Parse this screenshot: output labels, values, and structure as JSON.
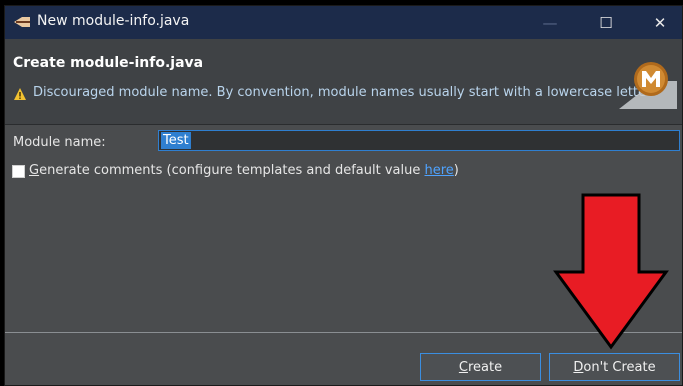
{
  "window": {
    "title": "New module-info.java",
    "controls": {
      "minimize": "—",
      "maximize": "☐",
      "close": "✕"
    }
  },
  "header": {
    "heading": "Create module-info.java",
    "warning": "Discouraged module name. By convention, module names usually start with a lowercase letter"
  },
  "form": {
    "module_name_label": "Module name:",
    "module_name_value": "Test",
    "generate_comments": {
      "prefix": "G",
      "text_after_mnemonic": "enerate comments (configure templates and default value ",
      "link": "here",
      "suffix": ")",
      "checked": false
    }
  },
  "buttons": {
    "create": {
      "mnemonic": "C",
      "rest": "reate"
    },
    "dont_create": {
      "mnemonic": "D",
      "rest": "on't Create"
    }
  },
  "colors": {
    "titlebar": "#1c2b4a",
    "background": "#4a4c4e",
    "accent": "#2f7fd0",
    "warning_text": "#b9d4ec",
    "link": "#4fa3ff",
    "annotation_arrow": "#e81c24"
  }
}
